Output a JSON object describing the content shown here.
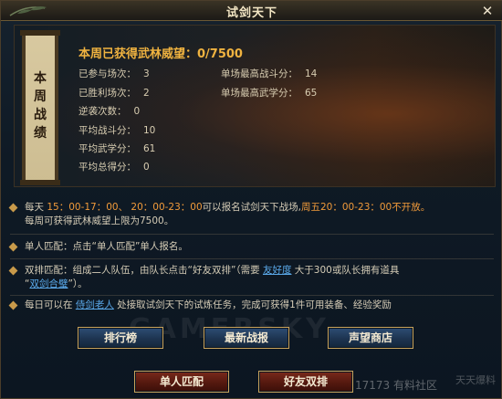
{
  "window": {
    "title": "试剑天下"
  },
  "scroll": {
    "text": "本周战绩"
  },
  "stats": {
    "headline": "本周已获得武林威望：0/7500",
    "left": [
      {
        "label": "已参与场次：",
        "value": "3"
      },
      {
        "label": "已胜利场次：",
        "value": "2"
      },
      {
        "label": "逆袭次数：",
        "value": "0"
      },
      {
        "label": "平均战斗分：",
        "value": "10"
      },
      {
        "label": "平均武学分：",
        "value": "61"
      },
      {
        "label": "平均总得分：",
        "value": "0"
      }
    ],
    "right": [
      {
        "label": "单场最高战斗分：",
        "value": "14"
      },
      {
        "label": "单场最高武学分：",
        "value": "65"
      }
    ]
  },
  "info": {
    "p1_a": "每天 ",
    "p1_time1": "15：00-17：00、",
    "p1_time2": "20：00-23：00",
    "p1_b": "可以报名试剑天下战场,",
    "p1_c": "周五20：00-23：00不开放。",
    "p1_line2": "每周可获得武林威望上限为7500。",
    "p2": "单人匹配：点击“单人匹配”单人报名。",
    "p3_a": "双排匹配：组成二人队伍，由队长点击“好友双排”（需要 ",
    "p3_link1": "友好度",
    "p3_b": " 大于300或队长拥有道具",
    "p3_link2": "双剑合璧",
    "p3_c": "”）。",
    "p3_pre2": "“",
    "p4_a": "每日可以在 ",
    "p4_link": "侍剑老人",
    "p4_b": " 处接取试剑天下的试炼任务，完成可获得1件可用装备、经验奖励"
  },
  "buttons": {
    "ranking": "排行榜",
    "latest_report": "最新战报",
    "shop": "声望商店",
    "solo": "单人匹配",
    "duo": "好友双排"
  },
  "watermark": {
    "gamersky": "GAMERSKY",
    "logo_text": "17173 有料社区",
    "logo_text2": "天天爆料"
  },
  "colors": {
    "accent_gold": "#f0b340",
    "highlight": "#f09a3a",
    "link": "#5aa8e8"
  },
  "icons": {
    "close": "close-icon",
    "bullet": "diamond-bullet-icon"
  }
}
